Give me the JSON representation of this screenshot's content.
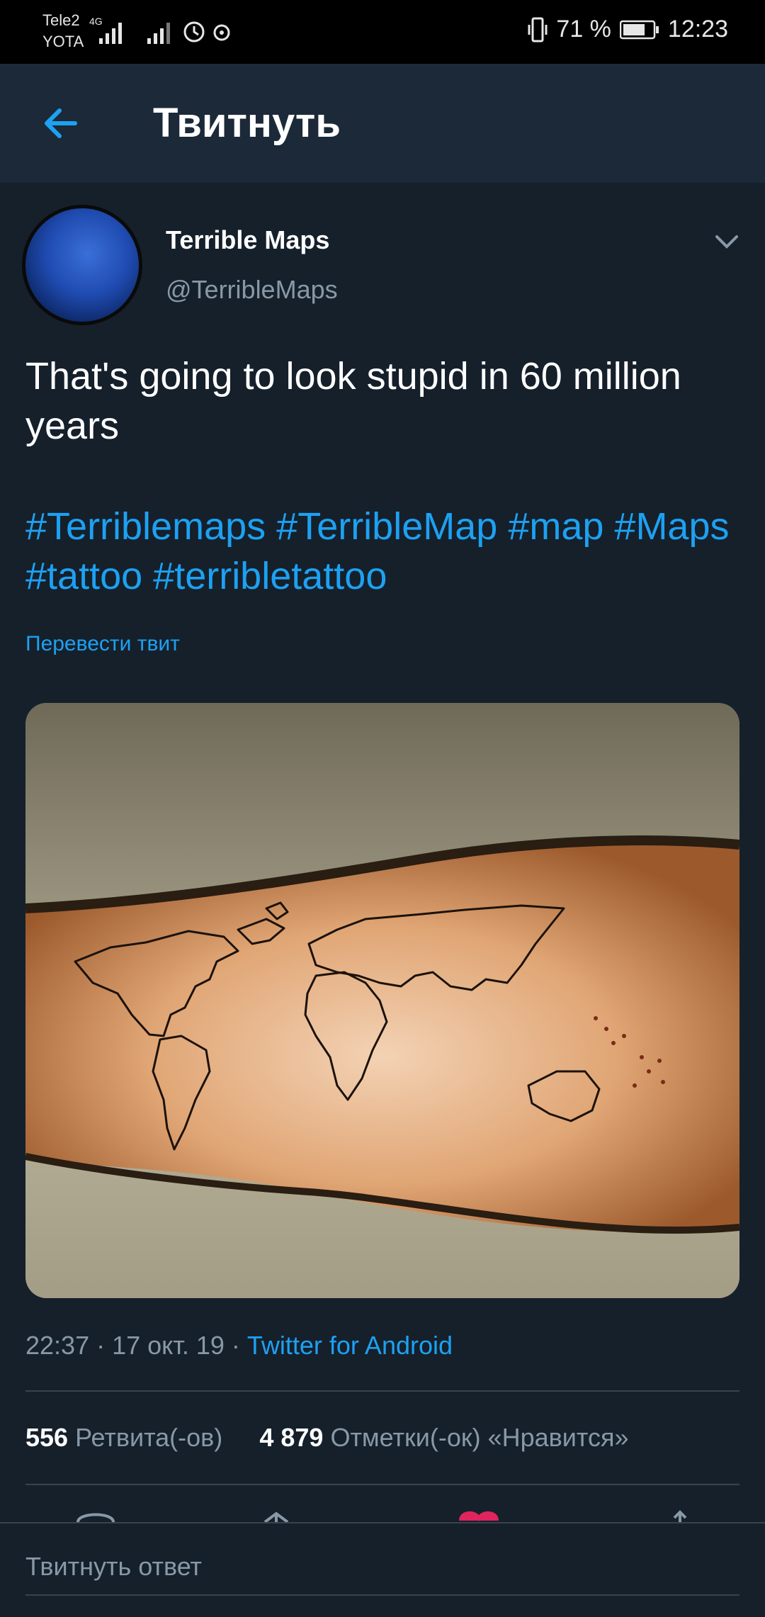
{
  "status_bar": {
    "carrier1": "Tele2",
    "carrier2": "YOTA",
    "network": "4G",
    "battery": "71 %",
    "time": "12:23"
  },
  "app_bar": {
    "title": "Твитнуть"
  },
  "tweet": {
    "author_name": "Terrible Maps",
    "author_handle": "@TerribleMaps",
    "text": "That's going to look stupid in 60 million years",
    "hashtags": [
      "#Terriblemaps",
      "#TerribleMap",
      "#map",
      "#Maps",
      "#tattoo",
      "#terribletattoo"
    ],
    "translate_label": "Перевести твит",
    "time": "22:37",
    "date": "17 окт. 19",
    "client": "Twitter for Android",
    "retweet_count": "556",
    "retweet_label": "Ретвита(-ов)",
    "like_count": "4 879",
    "like_label": "Отметки(-ок) «Нравится»"
  },
  "reply": {
    "placeholder": "Твитнуть ответ"
  },
  "colors": {
    "background": "#15202b",
    "app_bar": "#1c2938",
    "accent": "#1da1f2",
    "muted": "#8899a6",
    "like": "#e0245e"
  },
  "icons": [
    "vibrate-icon",
    "battery-icon",
    "alarm-icon",
    "back-arrow-icon",
    "chevron-down-icon",
    "reply-icon",
    "retweet-icon",
    "like-icon",
    "share-icon"
  ]
}
